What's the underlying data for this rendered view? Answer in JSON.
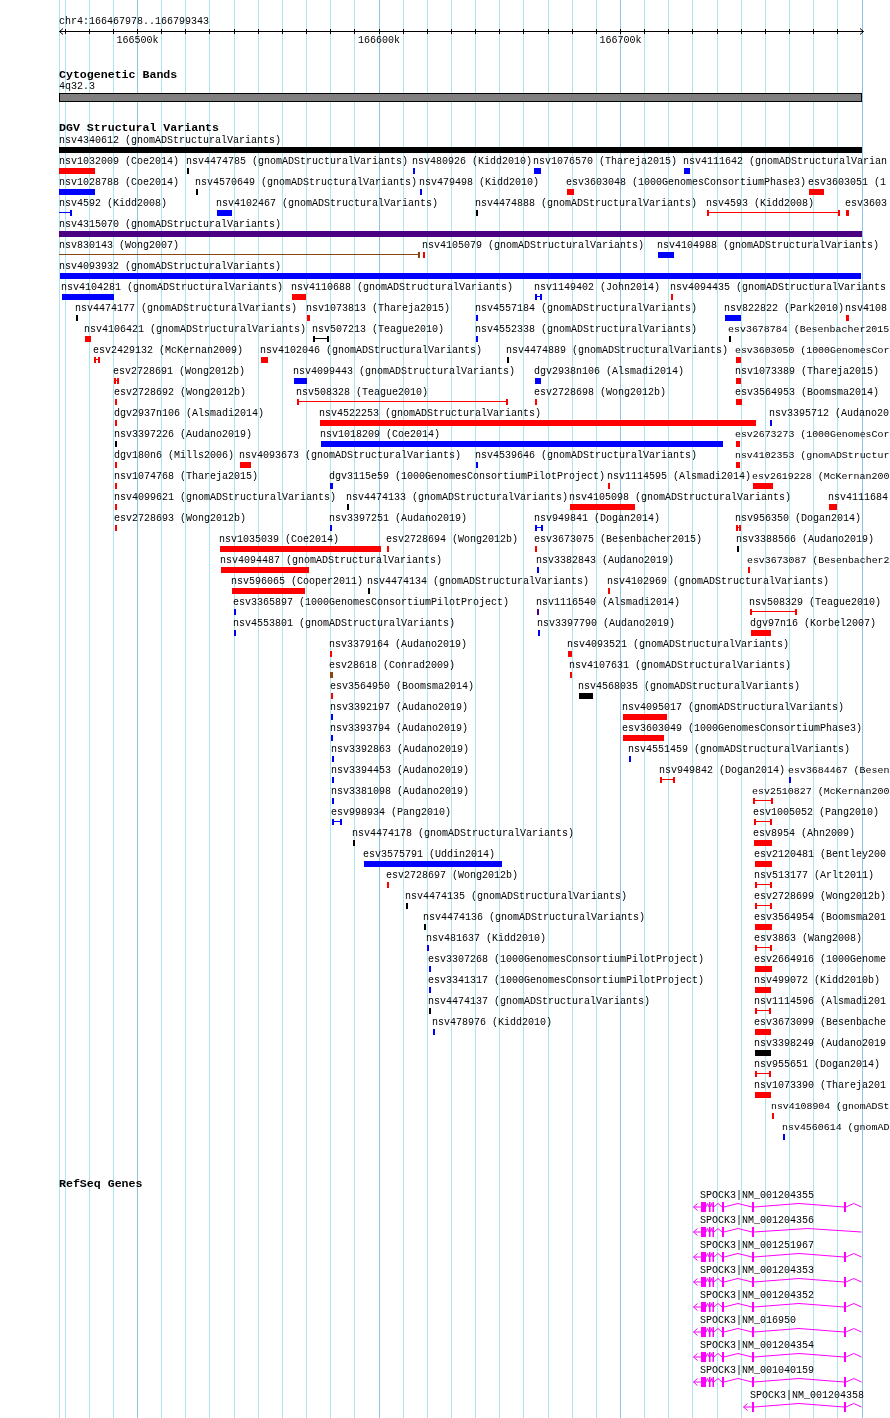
{
  "ruler": {
    "location": "chr4:166467978..166799343",
    "ticks": [
      "166500k",
      "166600k",
      "166700k"
    ]
  },
  "tracks": [
    {
      "kind": "cytoband",
      "title": "Cytogenetic Bands",
      "bands": [
        {
          "label": "4q32.3"
        }
      ]
    },
    {
      "kind": "variants",
      "title": "DGV Structural Variants",
      "rows": [
        [
          {
            "label": "nsv4340612 (gnomADStructuralVariants)",
            "kind": "bar",
            "color": "#000000"
          }
        ],
        [
          {
            "label": "nsv1032009 (Coe2014)",
            "kind": "bar",
            "color": "#ff0000"
          },
          {
            "label": "nsv4474785 (gnomADStructuralVariants)",
            "kind": "bar",
            "color": "#000000"
          },
          {
            "label": "nsv480926 (Kidd2010)",
            "kind": "bar",
            "color": "#0000ff"
          },
          {
            "label": "nsv1076570 (Thareja2015)",
            "kind": "bar",
            "color": "#0000ff"
          },
          {
            "label": "nsv4111642 (gnomADStructuralVarian",
            "kind": "bar",
            "color": "#0000ff"
          }
        ],
        [
          {
            "label": "nsv1028788 (Coe2014)",
            "kind": "bar",
            "color": "#0000ff"
          },
          {
            "label": "nsv4570649 (gnomADStructuralVariants)",
            "kind": "bar",
            "color": "#000000"
          },
          {
            "label": "nsv479498 (Kidd2010)",
            "kind": "bar",
            "color": "#0000ff"
          },
          {
            "label": "esv3603048 (1000GenomesConsortiumPhase3)",
            "kind": "bar",
            "color": "#ff0000"
          },
          {
            "label": "esv3603051 (1",
            "kind": "bar",
            "color": "#ff0000"
          }
        ],
        [
          {
            "label": "nsv4592 (Kidd2008)",
            "kind": "interval",
            "color": "#0000ff"
          },
          {
            "label": "nsv4102467 (gnomADStructuralVariants)",
            "kind": "bar",
            "color": "#0000ff"
          },
          {
            "label": "nsv4474888 (gnomADStructuralVariants)",
            "kind": "bar",
            "color": "#000000"
          },
          {
            "label": "nsv4593 (Kidd2008)",
            "kind": "interval",
            "color": "#ff0000"
          },
          {
            "label": "esv3603",
            "kind": "bar",
            "color": "#ff0000"
          }
        ],
        [
          {
            "label": "nsv4315070 (gnomADStructuralVariants)",
            "kind": "bar",
            "color": "#4b0082"
          }
        ],
        [
          {
            "label": "nsv830143 (Wong2007)",
            "kind": "interval",
            "color": "#8b4513"
          },
          {
            "label": "nsv4105079 (gnomADStructuralVariants)",
            "kind": "bar",
            "color": "#ff0000"
          },
          {
            "label": "nsv4104988 (gnomADStructuralVariants)",
            "kind": "bar",
            "color": "#0000ff"
          }
        ],
        [
          {
            "label": "nsv4093932 (gnomADStructuralVariants)",
            "kind": "bar",
            "color": "#0000ff"
          }
        ],
        [
          {
            "label": "nsv4104281 (gnomADStructuralVariants)",
            "kind": "bar",
            "color": "#0000ff"
          },
          {
            "label": "nsv4110688 (gnomADStructuralVariants)",
            "kind": "bar",
            "color": "#ff0000"
          },
          {
            "label": "nsv1149402 (John2014)",
            "kind": "interval",
            "color": "#0000ff"
          },
          {
            "label": "nsv4094435 (gnomADStructuralVariants",
            "kind": "bar",
            "color": "#ff0000"
          }
        ],
        [
          {
            "label": "nsv4474177 (gnomADStructuralVariants)",
            "kind": "bar",
            "color": "#000000"
          },
          {
            "label": "nsv1073813 (Thareja2015)",
            "kind": "bar",
            "color": "#ff0000"
          },
          {
            "label": "nsv4557184 (gnomADStructuralVariants)",
            "kind": "bar",
            "color": "#0000ff"
          },
          {
            "label": "nsv822822 (Park2010)",
            "kind": "bar",
            "color": "#0000ff"
          },
          {
            "label": "nsv4108",
            "kind": "bar",
            "color": "#ff0000"
          }
        ],
        [
          {
            "label": "nsv4106421 (gnomADStructuralVariants)",
            "kind": "bar",
            "color": "#ff0000"
          },
          {
            "label": "nsv507213 (Teague2010)",
            "kind": "interval",
            "color": "#000000"
          },
          {
            "label": "nsv4552338 (gnomADStructuralVariants)",
            "kind": "bar",
            "color": "#0000ff"
          },
          {
            "label": "esv3678784 (Besenbacher2015",
            "kind": "bar",
            "color": "#000000"
          }
        ],
        [
          {
            "label": "esv2429132 (McKernan2009)",
            "kind": "interval",
            "color": "#ff0000"
          },
          {
            "label": "nsv4102046 (gnomADStructuralVariants)",
            "kind": "bar",
            "color": "#ff0000"
          },
          {
            "label": "nsv4474889 (gnomADStructuralVariants)",
            "kind": "bar",
            "color": "#000000"
          },
          {
            "label": "esv3603050 (1000GenomesCor",
            "kind": "bar",
            "color": "#ff0000"
          }
        ],
        [
          {
            "label": "esv2728691 (Wong2012b)",
            "kind": "interval",
            "color": "#ff0000"
          },
          {
            "label": "nsv4099443 (gnomADStructuralVariants)",
            "kind": "bar",
            "color": "#0000ff"
          },
          {
            "label": "dgv2938n106 (Alsmadi2014)",
            "kind": "bar",
            "color": "#0000ff"
          },
          {
            "label": "nsv1073389 (Thareja2015)",
            "kind": "bar",
            "color": "#ff0000"
          }
        ],
        [
          {
            "label": "esv2728692 (Wong2012b)",
            "kind": "bar",
            "color": "#ff0000"
          },
          {
            "label": "nsv508328 (Teague2010)",
            "kind": "interval",
            "color": "#ff0000"
          },
          {
            "label": "esv2728698 (Wong2012b)",
            "kind": "bar",
            "color": "#ff0000"
          },
          {
            "label": "esv3564953 (Boomsma2014)",
            "kind": "bar",
            "color": "#ff0000"
          }
        ],
        [
          {
            "label": "dgv2937n106 (Alsmadi2014)",
            "kind": "bar",
            "color": "#ff0000"
          },
          {
            "label": "nsv4522253 (gnomADStructuralVariants)",
            "kind": "bar",
            "color": "#ff0000"
          },
          {
            "label": "nsv3395712 (Audano20",
            "kind": "bar",
            "color": "#0000ff"
          }
        ],
        [
          {
            "label": "nsv3397226 (Audano2019)",
            "kind": "bar",
            "color": "#000000"
          },
          {
            "label": "nsv1018209 (Coe2014)",
            "kind": "bar",
            "color": "#0000ff"
          },
          {
            "label": "esv2673273 (1000GenomesCor",
            "kind": "bar",
            "color": "#ff0000"
          }
        ],
        [
          {
            "label": "dgv180n6 (Mills2006)",
            "kind": "bar",
            "color": "#ff0000"
          },
          {
            "label": "nsv4093673 (gnomADStructuralVariants)",
            "kind": "bar",
            "color": "#ff0000"
          },
          {
            "label": "nsv4539646 (gnomADStructuralVariants)",
            "kind": "bar",
            "color": "#0000ff"
          },
          {
            "label": "nsv4102353 (gnomADStructur",
            "kind": "bar",
            "color": "#ff0000"
          }
        ],
        [
          {
            "label": "nsv1074768 (Thareja2015)",
            "kind": "bar",
            "color": "#ff0000"
          },
          {
            "label": "dgv3115e59 (1000GenomesConsortiumPilotProject)",
            "kind": "bar",
            "color": "#0000ff"
          },
          {
            "label": "nsv1114595 (Alsmadi2014)",
            "kind": "bar",
            "color": "#ff0000"
          },
          {
            "label": "esv2619228 (McKernan200",
            "kind": "bar",
            "color": "#ff0000"
          }
        ],
        [
          {
            "label": "nsv4099621 (gnomADStructuralVariants)",
            "kind": "bar",
            "color": "#ff0000"
          },
          {
            "label": "nsv4474133 (gnomADStructuralVariants)",
            "kind": "bar",
            "color": "#000000"
          },
          {
            "label": "nsv4105098 (gnomADStructuralVariants)",
            "kind": "bar",
            "color": "#ff0000"
          },
          {
            "label": "nsv4111684",
            "kind": "bar",
            "color": "#ff0000"
          }
        ],
        [
          {
            "label": "esv2728693 (Wong2012b)",
            "kind": "bar",
            "color": "#ff0000"
          },
          {
            "label": "nsv3397251 (Audano2019)",
            "kind": "bar",
            "color": "#0000ff"
          },
          {
            "label": "nsv949841 (Dogan2014)",
            "kind": "interval",
            "color": "#0000ff"
          },
          {
            "label": "nsv956350 (Dogan2014)",
            "kind": "interval",
            "color": "#ff0000"
          }
        ],
        [
          {
            "label": "nsv1035039 (Coe2014)",
            "kind": "bar",
            "color": "#ff0000"
          },
          {
            "label": "esv2728694 (Wong2012b)",
            "kind": "bar",
            "color": "#ff0000"
          },
          {
            "label": "esv3673075 (Besenbacher2015)",
            "kind": "bar",
            "color": "#ff0000"
          },
          {
            "label": "nsv3388566 (Audano2019)",
            "kind": "bar",
            "color": "#000000"
          }
        ],
        [
          {
            "label": "nsv4094487 (gnomADStructuralVariants)",
            "kind": "bar",
            "color": "#ff0000"
          },
          {
            "label": "nsv3382843 (Audano2019)",
            "kind": "bar",
            "color": "#0000ff"
          },
          {
            "label": "esv3673087 (Besenbacher2",
            "kind": "bar",
            "color": "#ff0000"
          }
        ],
        [
          {
            "label": "nsv596065 (Cooper2011)",
            "kind": "bar",
            "color": "#ff0000"
          },
          {
            "label": "nsv4474134 (gnomADStructuralVariants)",
            "kind": "bar",
            "color": "#000000"
          },
          {
            "label": "nsv4102969 (gnomADStructuralVariants)",
            "kind": "bar",
            "color": "#ff0000"
          }
        ],
        [
          {
            "label": "esv3365897 (1000GenomesConsortiumPilotProject)",
            "kind": "bar",
            "color": "#0000ff"
          },
          {
            "label": "nsv1116540 (Alsmadi2014)",
            "kind": "bar",
            "color": "#4b0082"
          },
          {
            "label": "nsv508329 (Teague2010)",
            "kind": "interval",
            "color": "#ff0000"
          }
        ],
        [
          {
            "label": "nsv4553801 (gnomADStructuralVariants)",
            "kind": "bar",
            "color": "#0000ff"
          },
          {
            "label": "nsv3397790 (Audano2019)",
            "kind": "bar",
            "color": "#0000ff"
          },
          {
            "label": "dgv97n16 (Korbel2007)",
            "kind": "bar",
            "color": "#ff0000"
          }
        ],
        [
          {
            "label": "nsv3379164 (Audano2019)",
            "kind": "bar",
            "color": "#ff0000"
          },
          {
            "label": "nsv4093521 (gnomADStructuralVariants)",
            "kind": "bar",
            "color": "#ff0000"
          }
        ],
        [
          {
            "label": "esv28618 (Conrad2009)",
            "kind": "bar",
            "color": "#8b4513"
          },
          {
            "label": "nsv4107631 (gnomADStructuralVariants)",
            "kind": "bar",
            "color": "#ff0000"
          }
        ],
        [
          {
            "label": "esv3564950 (Boomsma2014)",
            "kind": "bar",
            "color": "#ff0000"
          },
          {
            "label": "nsv4568035 (gnomADStructuralVariants)",
            "kind": "bar",
            "color": "#000000"
          }
        ],
        [
          {
            "label": "nsv3392197 (Audano2019)",
            "kind": "bar",
            "color": "#0000ff"
          },
          {
            "label": "nsv4095017 (gnomADStructuralVariants)",
            "kind": "bar",
            "color": "#ff0000"
          }
        ],
        [
          {
            "label": "nsv3393794 (Audano2019)",
            "kind": "bar",
            "color": "#0000ff"
          },
          {
            "label": "esv3603049 (1000GenomesConsortiumPhase3)",
            "kind": "bar",
            "color": "#ff0000"
          }
        ],
        [
          {
            "label": "nsv3392863 (Audano2019)",
            "kind": "bar",
            "color": "#0000ff"
          },
          {
            "label": "nsv4551459 (gnomADStructuralVariants)",
            "kind": "bar",
            "color": "#0000ff"
          }
        ],
        [
          {
            "label": "nsv3394453 (Audano2019)",
            "kind": "bar",
            "color": "#0000ff"
          },
          {
            "label": "nsv949842 (Dogan2014)",
            "kind": "interval",
            "color": "#ff0000"
          },
          {
            "label": "esv3684467 (Besen",
            "kind": "bar",
            "color": "#0000ff"
          }
        ],
        [
          {
            "label": "nsv3381098 (Audano2019)",
            "kind": "bar",
            "color": "#0000ff"
          },
          {
            "label": "esv2510827 (McKernan200",
            "kind": "interval",
            "color": "#ff0000"
          }
        ],
        [
          {
            "label": "esv998934 (Pang2010)",
            "kind": "interval",
            "color": "#0000ff"
          },
          {
            "label": "esv1005052 (Pang2010)",
            "kind": "interval",
            "color": "#ff0000"
          }
        ],
        [
          {
            "label": "nsv4474178 (gnomADStructuralVariants)",
            "kind": "bar",
            "color": "#000000"
          },
          {
            "label": "esv8954 (Ahn2009)",
            "kind": "bar",
            "color": "#ff0000"
          }
        ],
        [
          {
            "label": "esv3575791 (Uddin2014)",
            "kind": "bar",
            "color": "#0000ff"
          },
          {
            "label": "esv2120481 (Bentley200",
            "kind": "bar",
            "color": "#ff0000"
          }
        ],
        [
          {
            "label": "esv2728697 (Wong2012b)",
            "kind": "bar",
            "color": "#ff0000"
          },
          {
            "label": "nsv513177 (Arlt2011)",
            "kind": "interval",
            "color": "#ff0000"
          }
        ],
        [
          {
            "label": "nsv4474135 (gnomADStructuralVariants)",
            "kind": "bar",
            "color": "#000000"
          },
          {
            "label": "esv2728699 (Wong2012b)",
            "kind": "interval",
            "color": "#ff0000"
          }
        ],
        [
          {
            "label": "nsv4474136 (gnomADStructuralVariants)",
            "kind": "bar",
            "color": "#000000"
          },
          {
            "label": "esv3564954 (Boomsma201",
            "kind": "bar",
            "color": "#ff0000"
          }
        ],
        [
          {
            "label": "nsv481637 (Kidd2010)",
            "kind": "bar",
            "color": "#0000ff"
          },
          {
            "label": "esv3863 (Wang2008)",
            "kind": "interval",
            "color": "#ff0000"
          }
        ],
        [
          {
            "label": "esv3307268 (1000GenomesConsortiumPilotProject)",
            "kind": "bar",
            "color": "#0000ff"
          },
          {
            "label": "esv2664916 (1000Genome",
            "kind": "bar",
            "color": "#ff0000"
          }
        ],
        [
          {
            "label": "esv3341317 (1000GenomesConsortiumPilotProject)",
            "kind": "bar",
            "color": "#0000ff"
          },
          {
            "label": "nsv499072 (Kidd2010b)",
            "kind": "bar",
            "color": "#ff0000"
          }
        ],
        [
          {
            "label": "nsv4474137 (gnomADStructuralVariants)",
            "kind": "bar",
            "color": "#000000"
          },
          {
            "label": "nsv1114596 (Alsmadi201",
            "kind": "interval",
            "color": "#ff0000"
          }
        ],
        [
          {
            "label": "nsv478976 (Kidd2010)",
            "kind": "bar",
            "color": "#0000ff"
          },
          {
            "label": "esv3673099 (Besenbache",
            "kind": "bar",
            "color": "#ff0000"
          }
        ],
        [
          {
            "label": "nsv3398249 (Audano2019",
            "kind": "bar",
            "color": "#000000"
          }
        ],
        [
          {
            "label": "nsv955651 (Dogan2014)",
            "kind": "interval",
            "color": "#ff0000"
          }
        ],
        [
          {
            "label": "nsv1073390 (Thareja201",
            "kind": "bar",
            "color": "#ff0000"
          }
        ],
        [
          {
            "label": "nsv4108904 (gnomADSt",
            "kind": "bar",
            "color": "#ff0000"
          }
        ],
        [
          {
            "label": "nsv4560614 (gnomAD",
            "kind": "bar",
            "color": "#0000ff"
          }
        ]
      ]
    },
    {
      "kind": "genes",
      "title": "RefSeq Genes",
      "transcripts": [
        {
          "label": "SPOCK3|NM_001204355"
        },
        {
          "label": "SPOCK3|NM_001204356"
        },
        {
          "label": "SPOCK3|NM_001251967"
        },
        {
          "label": "SPOCK3|NM_001204353"
        },
        {
          "label": "SPOCK3|NM_001204352"
        },
        {
          "label": "SPOCK3|NM_016950"
        },
        {
          "label": "SPOCK3|NM_001204354"
        },
        {
          "label": "SPOCK3|NM_001040159"
        },
        {
          "label": "SPOCK3|NM_001204358"
        }
      ]
    }
  ]
}
